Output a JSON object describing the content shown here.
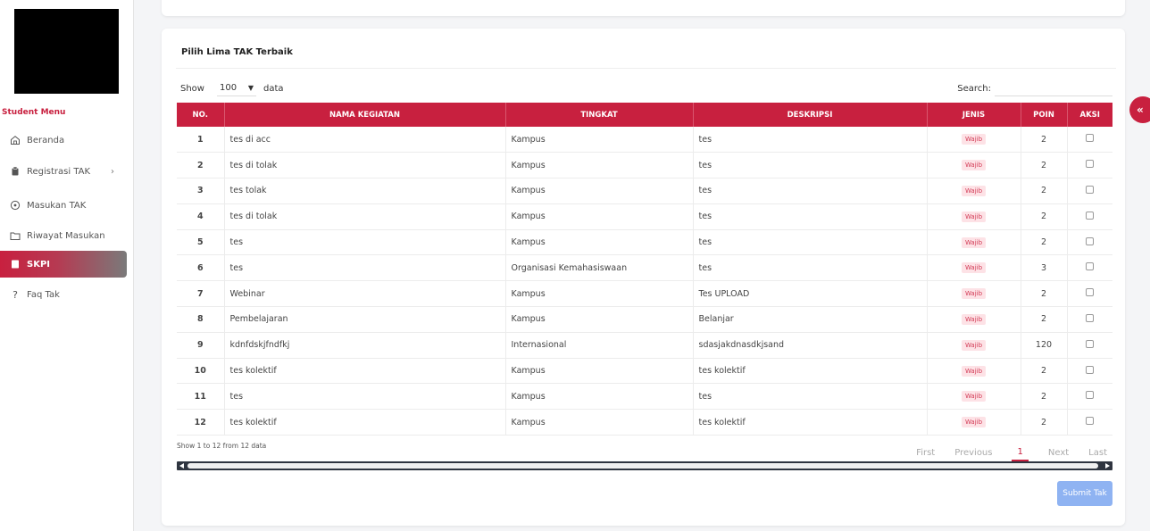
{
  "sidebar": {
    "menu_title": "Student Menu",
    "items": [
      {
        "label": "Beranda",
        "icon": "home-icon"
      },
      {
        "label": "Registrasi TAK",
        "icon": "clipboard-icon"
      },
      {
        "label": "Masukan TAK",
        "icon": "circle-plus-icon"
      },
      {
        "label": "Riwayat Masukan",
        "icon": "folder-icon"
      },
      {
        "label": "SKPI",
        "icon": "document-icon"
      },
      {
        "label": "Faq Tak",
        "icon": "question-icon"
      }
    ],
    "chevron": "›"
  },
  "card": {
    "title": "Pilih Lima TAK Terbaik",
    "show_label": "Show",
    "show_value": "100",
    "data_label": "data",
    "search_label": "Search:",
    "search_value": ""
  },
  "table": {
    "headers": [
      "NO.",
      "NAMA KEGIATAN",
      "TINGKAT",
      "DESKRIPSI",
      "JENIS",
      "POIN",
      "AKSI"
    ],
    "rows": [
      {
        "no": "1",
        "nama": "tes di acc",
        "tingkat": "Kampus",
        "deskripsi": "tes",
        "jenis": "Wajib",
        "poin": "2"
      },
      {
        "no": "2",
        "nama": "tes di tolak",
        "tingkat": "Kampus",
        "deskripsi": "tes",
        "jenis": "Wajib",
        "poin": "2"
      },
      {
        "no": "3",
        "nama": "tes tolak",
        "tingkat": "Kampus",
        "deskripsi": "tes",
        "jenis": "Wajib",
        "poin": "2"
      },
      {
        "no": "4",
        "nama": "tes di tolak",
        "tingkat": "Kampus",
        "deskripsi": "tes",
        "jenis": "Wajib",
        "poin": "2"
      },
      {
        "no": "5",
        "nama": "tes",
        "tingkat": "Kampus",
        "deskripsi": "tes",
        "jenis": "Wajib",
        "poin": "2"
      },
      {
        "no": "6",
        "nama": "tes",
        "tingkat": "Organisasi Kemahasiswaan",
        "deskripsi": "tes",
        "jenis": "Wajib",
        "poin": "3"
      },
      {
        "no": "7",
        "nama": "Webinar",
        "tingkat": "Kampus",
        "deskripsi": "Tes UPLOAD",
        "jenis": "Wajib",
        "poin": "2"
      },
      {
        "no": "8",
        "nama": "Pembelajaran",
        "tingkat": "Kampus",
        "deskripsi": "Belanjar",
        "jenis": "Wajib",
        "poin": "2"
      },
      {
        "no": "9",
        "nama": "kdnfdskjfndfkj",
        "tingkat": "Internasional",
        "deskripsi": "sdasjakdnasdkjsand",
        "jenis": "Wajib",
        "poin": "120"
      },
      {
        "no": "10",
        "nama": "tes kolektif",
        "tingkat": "Kampus",
        "deskripsi": "tes kolektif",
        "jenis": "Wajib",
        "poin": "2"
      },
      {
        "no": "11",
        "nama": "tes",
        "tingkat": "Kampus",
        "deskripsi": "tes",
        "jenis": "Wajib",
        "poin": "2"
      },
      {
        "no": "12",
        "nama": "tes kolektif",
        "tingkat": "Kampus",
        "deskripsi": "tes kolektif",
        "jenis": "Wajib",
        "poin": "2"
      }
    ]
  },
  "footer": {
    "info": "Show 1 to 12 from 12 data",
    "pager": {
      "first": "First",
      "previous": "Previous",
      "current": "1",
      "next": "Next",
      "last": "Last"
    },
    "submit": "Submit Tak"
  },
  "collapse_button": "«",
  "colors": {
    "accent": "#c8203f",
    "submit": "#8fb3f2"
  }
}
